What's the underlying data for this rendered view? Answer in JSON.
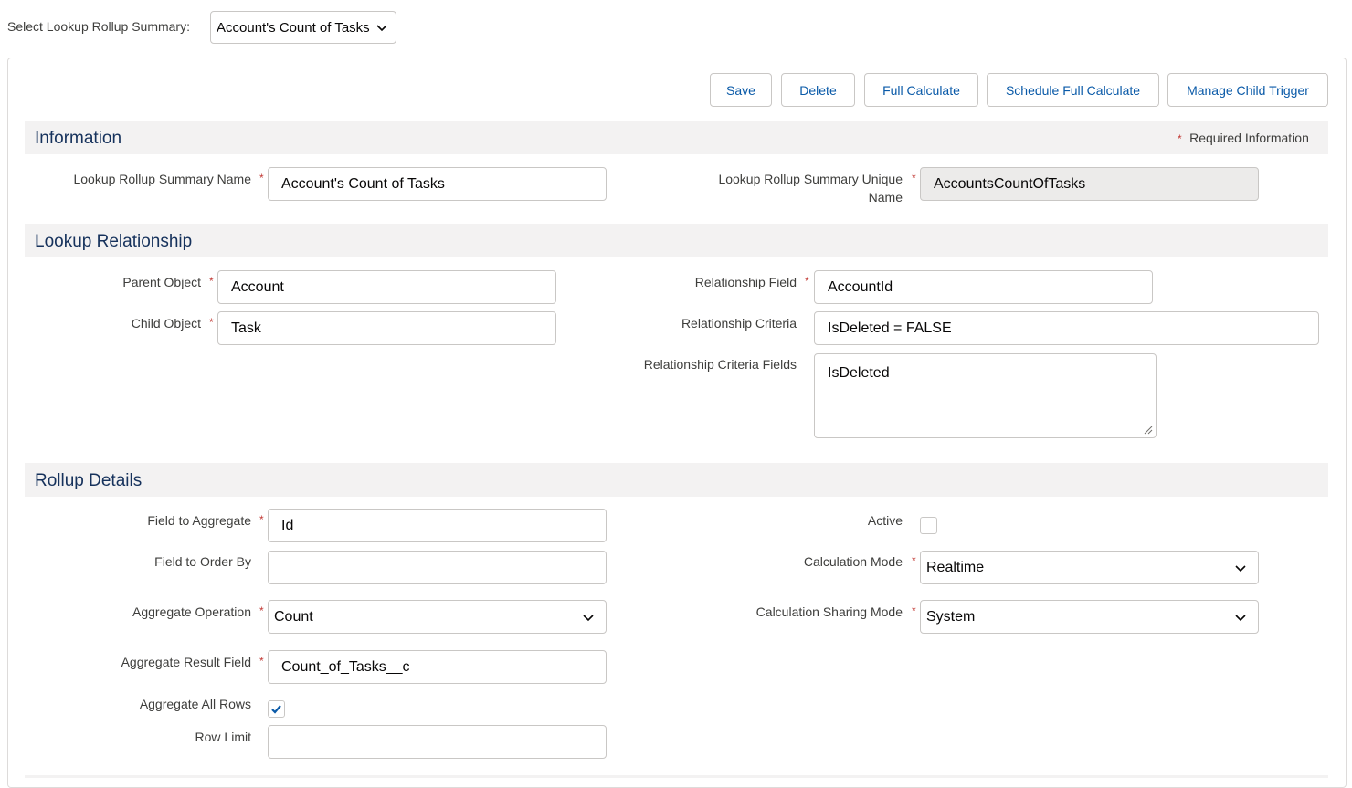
{
  "header": {
    "select_label": "Select Lookup Rollup Summary:",
    "select_value": "Account's Count of Tasks"
  },
  "toolbar": {
    "save_label": "Save",
    "delete_label": "Delete",
    "full_calculate_label": "Full Calculate",
    "schedule_full_calculate_label": "Schedule Full Calculate",
    "manage_child_trigger_label": "Manage Child Trigger"
  },
  "information": {
    "title": "Information",
    "required_star": "*",
    "required_text": "Required Information",
    "name_label": "Lookup Rollup Summary Name",
    "name_value": "Account's Count of Tasks",
    "unique_name_label_line1": "Lookup Rollup Summary Unique",
    "unique_name_label_line2": "Name",
    "unique_name_value": "AccountsCountOfTasks"
  },
  "lookup_relationship": {
    "title": "Lookup Relationship",
    "parent_object_label": "Parent Object",
    "parent_object_value": "Account",
    "child_object_label": "Child Object",
    "child_object_value": "Task",
    "relationship_field_label": "Relationship Field",
    "relationship_field_value": "AccountId",
    "relationship_criteria_label": "Relationship Criteria",
    "relationship_criteria_value": "IsDeleted = FALSE",
    "relationship_criteria_fields_label": "Relationship Criteria Fields",
    "relationship_criteria_fields_value": "IsDeleted"
  },
  "rollup_details": {
    "title": "Rollup Details",
    "field_to_aggregate_label": "Field to Aggregate",
    "field_to_aggregate_value": "Id",
    "field_to_order_by_label": "Field to Order By",
    "field_to_order_by_value": "",
    "aggregate_operation_label": "Aggregate Operation",
    "aggregate_operation_value": "Count",
    "aggregate_result_field_label": "Aggregate Result Field",
    "aggregate_result_field_value": "Count_of_Tasks__c",
    "aggregate_all_rows_label": "Aggregate All Rows",
    "aggregate_all_rows_checked": true,
    "row_limit_label": "Row Limit",
    "row_limit_value": "",
    "active_label": "Active",
    "active_checked": false,
    "calculation_mode_label": "Calculation Mode",
    "calculation_mode_value": "Realtime",
    "calculation_sharing_mode_label": "Calculation Sharing Mode",
    "calculation_sharing_mode_value": "System"
  },
  "colors": {
    "link_blue": "#0a5aa8",
    "required_red": "#c23934",
    "section_bg": "#f3f2f2",
    "readonly_bg": "#ecebea"
  },
  "icons": [
    "chevron-down-icon",
    "check-icon",
    "resize-handle-icon"
  ]
}
